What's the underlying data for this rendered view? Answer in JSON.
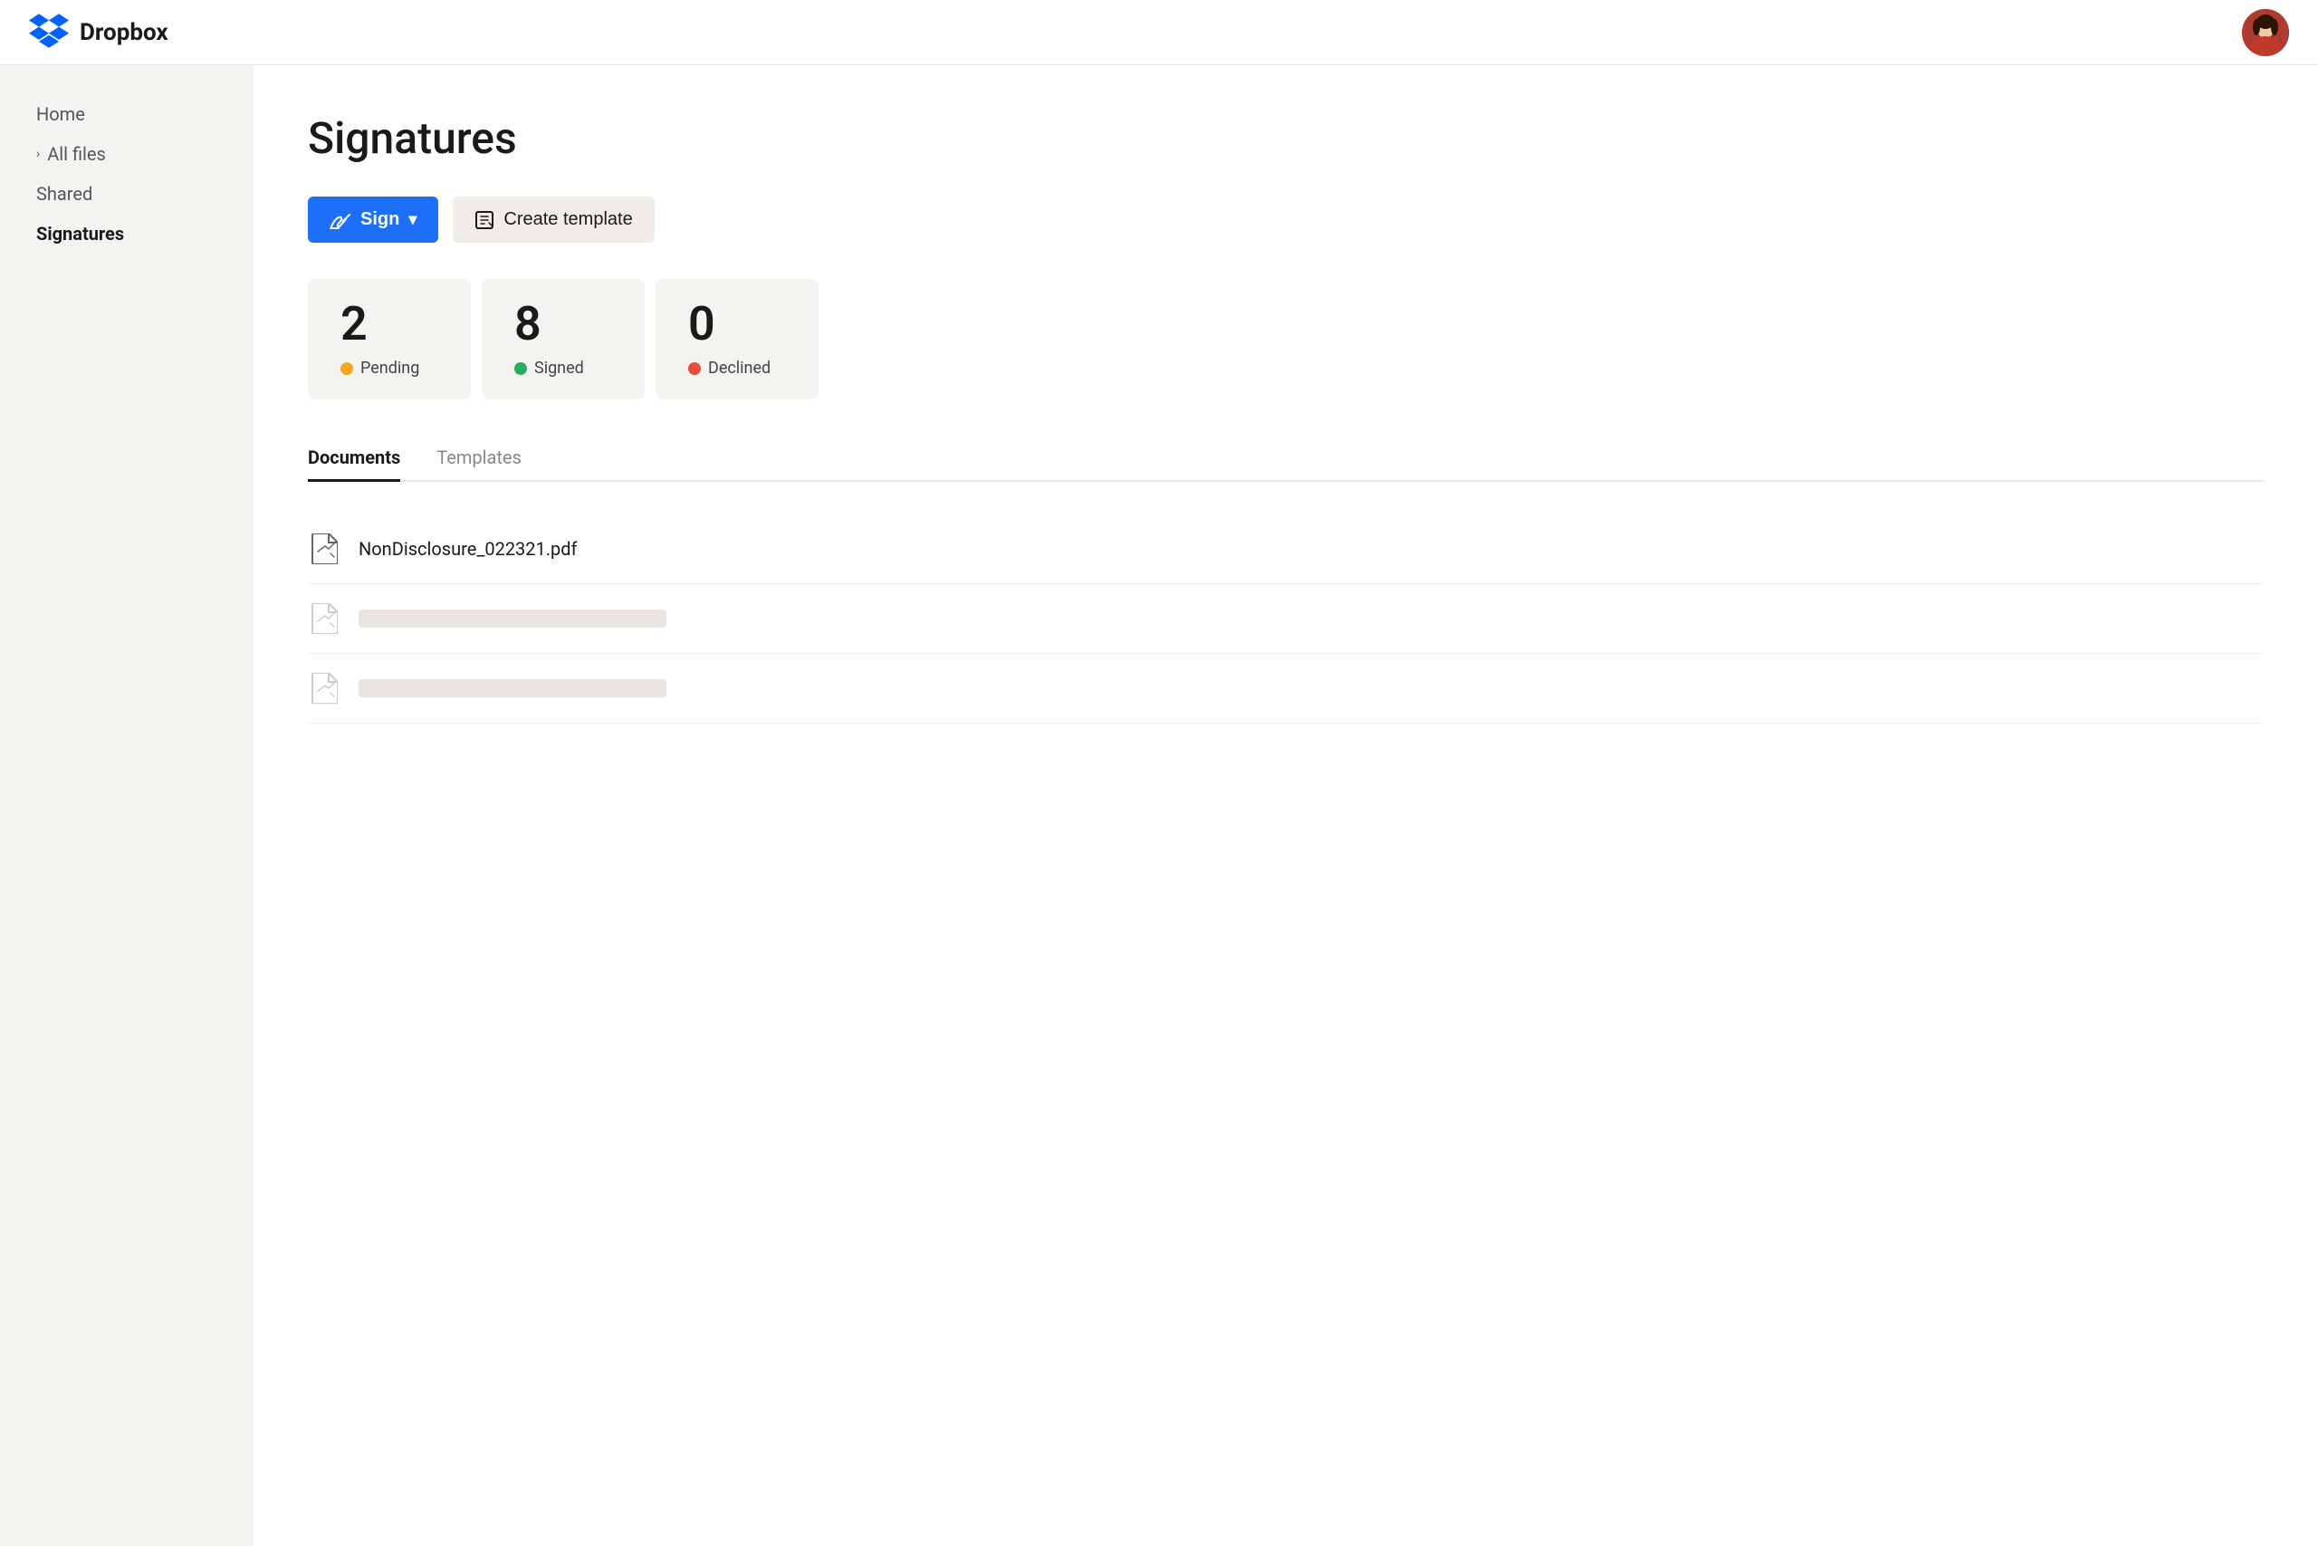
{
  "navbar": {
    "logo_text": "Dropbox",
    "avatar_label": "User avatar"
  },
  "sidebar": {
    "items": [
      {
        "id": "home",
        "label": "Home",
        "active": false,
        "arrow": false
      },
      {
        "id": "all-files",
        "label": "All files",
        "active": false,
        "arrow": true
      },
      {
        "id": "shared",
        "label": "Shared",
        "active": false,
        "arrow": false
      },
      {
        "id": "signatures",
        "label": "Signatures",
        "active": true,
        "arrow": false
      }
    ]
  },
  "main": {
    "page_title": "Signatures",
    "buttons": {
      "sign_label": "Sign",
      "sign_dropdown_arrow": "▾",
      "create_template_label": "Create template"
    },
    "stats": [
      {
        "id": "pending",
        "number": "2",
        "label": "Pending",
        "dot_class": "dot-pending"
      },
      {
        "id": "signed",
        "number": "8",
        "label": "Signed",
        "dot_class": "dot-signed"
      },
      {
        "id": "declined",
        "number": "0",
        "label": "Declined",
        "dot_class": "dot-declined"
      }
    ],
    "tabs": [
      {
        "id": "documents",
        "label": "Documents",
        "active": true
      },
      {
        "id": "templates",
        "label": "Templates",
        "active": false
      }
    ],
    "documents": [
      {
        "id": "doc1",
        "name": "NonDisclosure_022321.pdf",
        "placeholder": false
      },
      {
        "id": "doc2",
        "name": "",
        "placeholder": true
      },
      {
        "id": "doc3",
        "name": "",
        "placeholder": true
      }
    ]
  }
}
